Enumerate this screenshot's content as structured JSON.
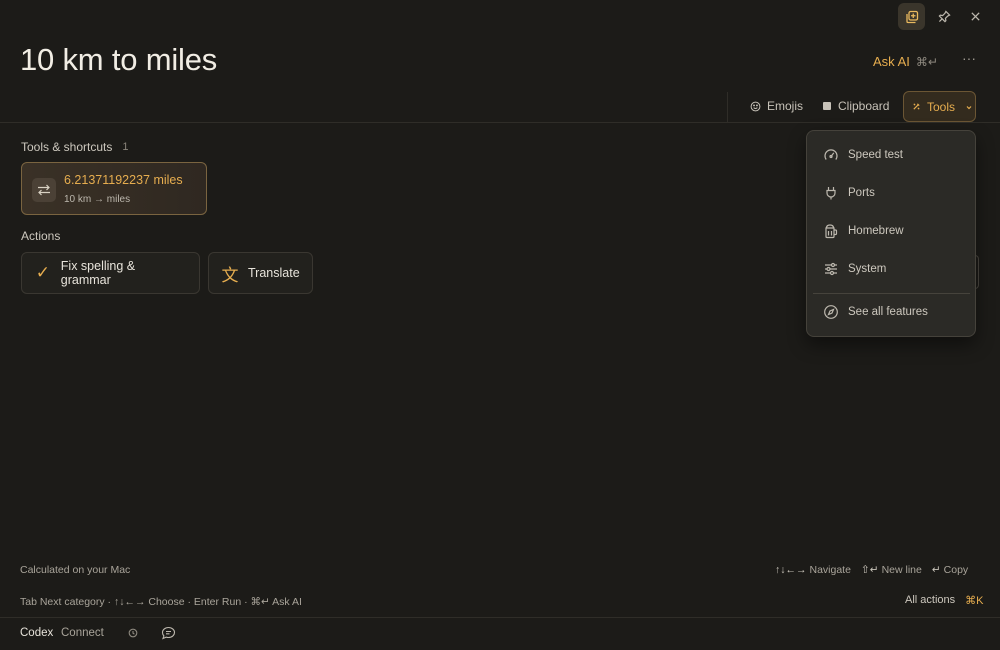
{
  "window": {
    "controls": [
      {
        "name": "detach-icon"
      },
      {
        "name": "pin-icon"
      },
      {
        "name": "close-icon"
      }
    ]
  },
  "search": {
    "query": "10 km to miles",
    "ask_ai_label": "Ask AI",
    "ask_ai_shortcut": "⌘↵",
    "more_label": "···"
  },
  "tabs": {
    "emojis": "Emojis",
    "clipboard": "Clipboard",
    "tools": "Tools"
  },
  "sections": {
    "tools_title": "Tools & shortcuts",
    "tools_count": "1",
    "actions_title": "Actions"
  },
  "result": {
    "value": "6.21371192237 miles",
    "conversion": "10 km → miles"
  },
  "actions": [
    {
      "label": "Fix spelling & grammar",
      "glyph": "✓"
    },
    {
      "label": "Translate",
      "glyph": "文"
    }
  ],
  "tools_menu": {
    "items": [
      {
        "label": "Speed test",
        "icon": "gauge-icon"
      },
      {
        "label": "Ports",
        "icon": "plug-icon"
      },
      {
        "label": "Homebrew",
        "icon": "mug-icon"
      },
      {
        "label": "System",
        "icon": "sliders-icon"
      }
    ],
    "see_all": "See all features"
  },
  "footer": {
    "left_note": "Calculated on your Mac",
    "hints_right": [
      {
        "keys": "↑↓←→",
        "label": "Navigate"
      },
      {
        "keys": "⇧↵",
        "label": "New line"
      },
      {
        "keys": "↵",
        "label": "Copy"
      }
    ],
    "shortcuts_line": "Tab Next category · ↑↓←→ Choose · Enter Run · ⌘↵ Ask AI",
    "all_actions": "All actions",
    "all_actions_kbd": "⌘K"
  },
  "bottom_bar": {
    "codex": "Codex",
    "connect": "Connect"
  },
  "colors": {
    "background": "#1c1b18",
    "accent": "#e6ad4f",
    "card_border": "#7a6440"
  }
}
